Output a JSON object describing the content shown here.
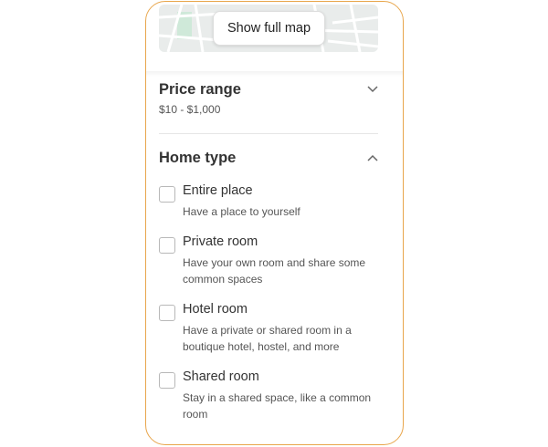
{
  "map": {
    "button_label": "Show full map",
    "colors": {
      "background": "#e9eceb",
      "streets": "#ffffff",
      "park": "#cfe9d9"
    }
  },
  "price_range": {
    "title": "Price range",
    "value": "$10 - $1,000",
    "state": "collapsed",
    "chevron_icon": "chevron-down-icon"
  },
  "home_type": {
    "title": "Home type",
    "state": "expanded",
    "chevron_icon": "chevron-up-icon",
    "options": [
      {
        "label": "Entire place",
        "description": "Have a place to yourself",
        "checked": false
      },
      {
        "label": "Private room",
        "description": "Have your own room and share some common spaces",
        "checked": false
      },
      {
        "label": "Hotel room",
        "description": "Have a private or shared room in a boutique hotel, hostel, and more",
        "checked": false
      },
      {
        "label": "Shared room",
        "description": "Stay in a shared space, like a common room",
        "checked": false
      }
    ]
  },
  "colors": {
    "panel_border": "#e8a64c",
    "text": "#333333",
    "muted": "#555555"
  }
}
